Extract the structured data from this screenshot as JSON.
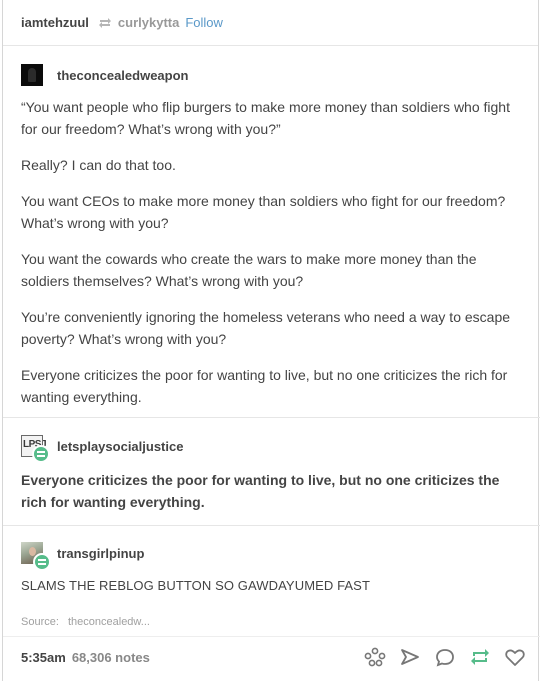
{
  "header": {
    "username": "iamtehzuul",
    "reblogged_from": "curlykytta",
    "follow_label": "Follow"
  },
  "posts": [
    {
      "blog": "theconcealedweapon",
      "paragraphs": [
        "“You want people who flip burgers to make more money than soldiers who fight for our freedom? What’s wrong with you?”",
        "Really? I can do that too.",
        "You want CEOs to make more money than soldiers who fight for our freedom? What’s wrong with you?",
        "You want the cowards who create the wars to make more money than the soldiers themselves? What’s wrong with you?",
        "You’re conveniently ignoring the homeless veterans who need a way to escape poverty? What’s wrong with you?",
        "Everyone criticizes the poor for wanting to live, but no one criticizes the rich for wanting everything."
      ]
    },
    {
      "blog": "letsplaysocialjustice",
      "avatar_text": "LPSJ",
      "paragraphs": [
        "Everyone criticizes the poor for wanting to live, but no one criticizes the rich for wanting everything."
      ]
    },
    {
      "blog": "transgirlpinup",
      "paragraphs": [
        "SLAMS THE REBLOG BUTTON SO GAWDAYUMED FAST"
      ]
    }
  ],
  "source": {
    "label": "Source:",
    "value": "theconcealedw..."
  },
  "footer": {
    "time": "5:35am",
    "notes": "68,306 notes",
    "actions": [
      "share-icon",
      "send-icon",
      "reply-icon",
      "reblog-icon",
      "like-icon"
    ]
  },
  "colors": {
    "link": "#5a98c8",
    "reblog_badge": "#56bc8a",
    "text": "#444444",
    "muted": "#999999"
  }
}
